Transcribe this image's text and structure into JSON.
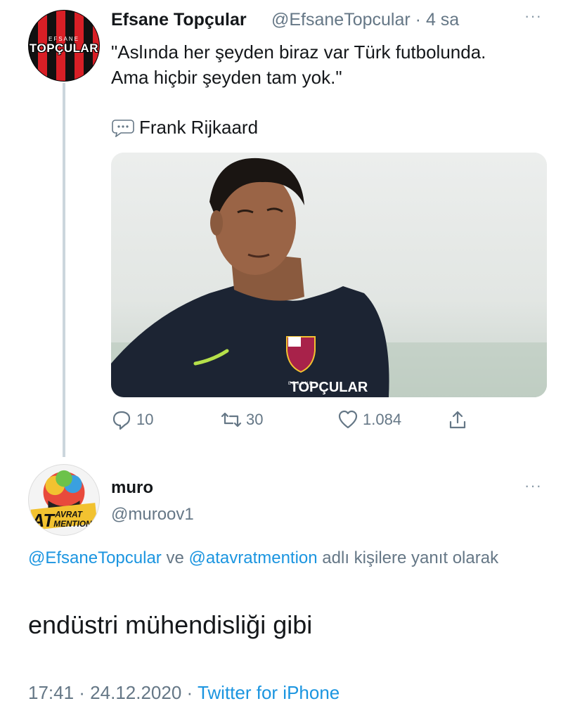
{
  "tweet": {
    "avatar_logo_top": "EFSANE",
    "avatar_logo": "TOPÇULAR",
    "author_name": "Efsane Topçular",
    "author_handle": "@EfsaneTopcular",
    "time": "· 4 sa",
    "more": "···",
    "text_line1": "\"Aslında her şeyden biraz var Türk futbolunda.",
    "text_line2": "Ama hiçbir şeyden tam yok.\"",
    "quote_author": "Frank Rijkaard",
    "photo_watermark_top": "EFSANE",
    "photo_watermark": "TOPÇULAR",
    "reply_count": "10",
    "retweet_count": "30",
    "like_count": "1.084"
  },
  "reply": {
    "avatar_text_top": "AVRAT",
    "avatar_text_at": "AT",
    "avatar_text_bottom": "MENTION",
    "author_name": "muro",
    "author_handle": "@muroov1",
    "more": "···",
    "replying_mention1": "@EfsaneTopcular",
    "replying_connector": "ve",
    "replying_mention2": "@atavratmention",
    "replying_suffix": "adlı kişilere yanıt olarak",
    "text": "endüstri mühendisliği gibi",
    "time": "17:41 · 24.12.2020 ·",
    "source": "Twitter for iPhone"
  },
  "colors": {
    "link": "#1b95e0",
    "secondary": "#657786",
    "thread_line": "#ccd6dd"
  },
  "icons": [
    "speech-bubble-icon",
    "reply-icon",
    "retweet-icon",
    "like-icon",
    "share-icon",
    "more-icon"
  ]
}
